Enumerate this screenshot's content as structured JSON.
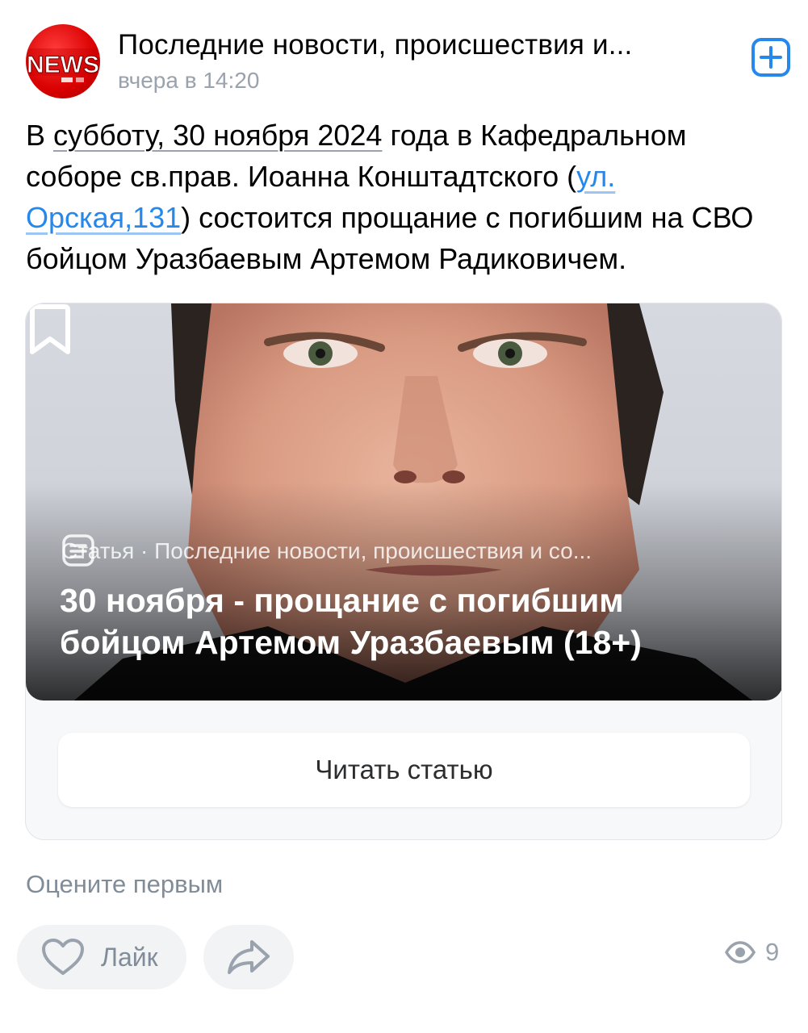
{
  "header": {
    "avatar_text": "NEWS",
    "channel_title": "Последние новости, происшествия и...",
    "time": "вчера в 14:20"
  },
  "post": {
    "text_parts": {
      "p1": "В ",
      "u1": "субботу, 30 ноября 2024",
      "p2": " года в Кафедральном соборе св.прав. Иоанна Конштадтского (",
      "link": "ул. Орская,131",
      "p3": ") состоится прощание с погибшим на СВО бойцом Уразбаевым Артемом Радиковичем."
    }
  },
  "article": {
    "meta": "Статья · Последние новости, происшествия и со...",
    "title": "30 ноября - прощание с погибшим бойцом Артемом Уразбаевым (18+)",
    "read_button": "Читать статью"
  },
  "footer": {
    "rate_first": "Оцените первым",
    "like_label": "Лайк",
    "views": "9"
  },
  "colors": {
    "accent": "#2688eb",
    "muted": "#99a2ad",
    "button_bg": "#f2f3f5"
  },
  "icons": [
    "subscribe-plus-icon",
    "bookmark-icon",
    "article-icon",
    "heart-icon",
    "share-icon",
    "eye-icon"
  ]
}
